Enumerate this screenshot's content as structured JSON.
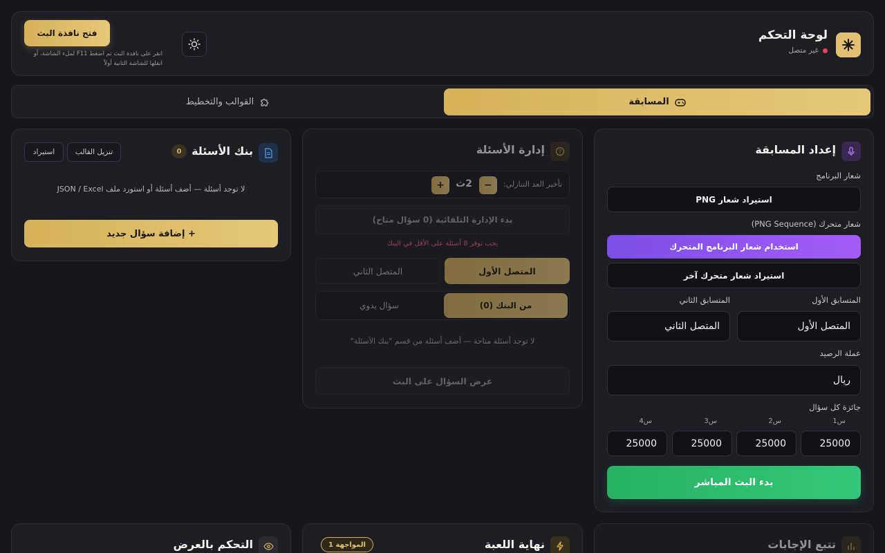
{
  "header": {
    "title": "لوحة التحكم",
    "status": "غير متصل",
    "status_color": "#e0455c",
    "open_window_button": "فتح نافذة البث",
    "open_window_hint": "انقر على نافذة البث ثم اضغط F11 لملء الشاشة، أو انقلها للشاشة الثانية أولاً",
    "theme_icon": "sun-icon"
  },
  "tabs": [
    {
      "label": "المسابقة",
      "icon": "gamepad-icon",
      "active": true
    },
    {
      "label": "القوالب والتخطيط",
      "icon": "puzzle-icon",
      "active": false
    }
  ],
  "setup": {
    "title": "إعداد المسابقة",
    "program_logo_label": "شعار البرنامج",
    "import_png_button": "استيراد شعار PNG",
    "animated_logo_label": "شعار متحرك (PNG Sequence)",
    "use_animated_button": "استخدام شعار البرنامج المتحرك",
    "import_other_button": "استيراد شعار متحرك آخر",
    "contestant1_label": "المتسابق الأول",
    "contestant2_label": "المتسابق الثاني",
    "contestant1_value": "المتصل الأول",
    "contestant2_value": "المتصل الثاني",
    "currency_label": "عملة الرصيد",
    "currency_value": "ريال",
    "prize_label": "جائزة كل سؤال",
    "prizes": [
      {
        "label": "س1",
        "value": "25000"
      },
      {
        "label": "س2",
        "value": "25000"
      },
      {
        "label": "س3",
        "value": "25000"
      },
      {
        "label": "س4",
        "value": "25000"
      }
    ],
    "start_live_button": "بدء البث المباشر"
  },
  "questions_mgmt": {
    "title": "إدارة الأسئلة",
    "countdown_label": "تأخير العد التنازلي:",
    "countdown_value": "2ث",
    "minus": "−",
    "plus": "+",
    "auto_button": "بدء الإدارة التلقائية (0 سؤال متاح)",
    "warning": "يجب توفر 8 أسئلة على الأقل في البنك",
    "caller1": "المتصل الأول",
    "caller2": "المتصل الثاني",
    "from_bank": "من البنك (0)",
    "manual": "سؤال يدوي",
    "empty_text": "لا توجد أسئلة متاحة — أضف أسئلة من قسم \"بنك الأسئلة\"",
    "show_question_button": "عرض السؤال على البث"
  },
  "bank": {
    "title": "بنك الأسئلة",
    "count": "0",
    "download_template": "تنزيل القالب",
    "import": "استيراد",
    "empty_text": "لا توجد أسئلة — أضف أسئلة أو استورد ملف JSON / Excel",
    "add_button": "+ إضافة سؤال جديد"
  },
  "bottom": {
    "tracking_title": "تتبع الإجابات",
    "game_end_title": "نهاية اللعبة",
    "match_badge": "المواجهة 1",
    "display_title": "التحكم بالعرض"
  },
  "colors": {
    "gold": "#d6b25a",
    "purple": "#a259f7",
    "green": "#2ec27e",
    "warning_red": "#d9485f"
  }
}
